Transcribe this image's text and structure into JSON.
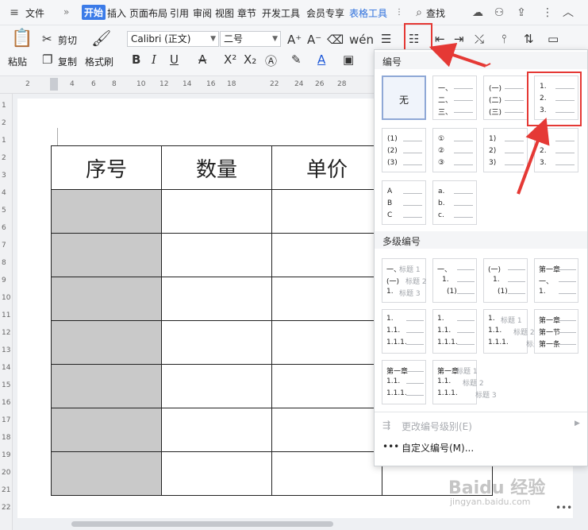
{
  "menubar": {
    "file": "文件",
    "more": "»",
    "tabs": [
      "开始",
      "插入",
      "页面布局",
      "引用",
      "审阅",
      "视图",
      "章节",
      "开发工具",
      "会员专享",
      "表格工具"
    ],
    "search": "查找"
  },
  "ribbon": {
    "paste": "粘贴",
    "cut": "剪切",
    "copy": "复制",
    "format_painter": "格式刷",
    "font_name": "Calibri (正文)",
    "font_size": "二号",
    "bold": "B",
    "italic": "I",
    "underline": "U",
    "strikethrough": "A",
    "superscript": "X²",
    "subscript": "X₂",
    "font_grow": "A⁺",
    "font_shrink": "A⁻"
  },
  "ruler": {
    "h_ticks": [
      "2",
      "2",
      "4",
      "6",
      "8",
      "10",
      "12",
      "14",
      "16",
      "18",
      "22",
      "24",
      "26",
      "28"
    ],
    "v_ticks": [
      "1",
      "2",
      "1",
      "2",
      "3",
      "4",
      "5",
      "6",
      "7",
      "8",
      "9",
      "10",
      "11",
      "12",
      "13",
      "14",
      "15",
      "16",
      "17",
      "18",
      "19",
      "20",
      "21",
      "22"
    ]
  },
  "document": {
    "headers": [
      "序号",
      "数量",
      "单价"
    ],
    "row_count": 7
  },
  "numbering_panel": {
    "section_numbering": "编号",
    "none_label": "无",
    "styles": [
      [
        "一、",
        "二、",
        "三、"
      ],
      [
        "(一)",
        "(二)",
        "(三)"
      ],
      [
        "1.",
        "2.",
        "3."
      ],
      [
        "(1)",
        "(2)",
        "(3)"
      ],
      [
        "①",
        "②",
        "③"
      ],
      [
        "1)",
        "2)",
        "3)"
      ],
      [
        "1.",
        "2.",
        "3."
      ],
      [
        "A",
        "B",
        "C"
      ],
      [
        "a.",
        "b.",
        "c."
      ]
    ],
    "section_multilevel": "多级编号",
    "multilevel": [
      [
        [
          "一、",
          "标题 1"
        ],
        [
          "(一)",
          "标题 2"
        ],
        [
          "1.",
          "标题 3"
        ]
      ],
      [
        [
          "一、",
          ""
        ],
        [
          "1.",
          ""
        ],
        [
          "(1)",
          ""
        ]
      ],
      [
        [
          "(一)",
          ""
        ],
        [
          "1.",
          ""
        ],
        [
          "(1)",
          ""
        ]
      ],
      [
        [
          "第一章",
          ""
        ],
        [
          "一、",
          ""
        ],
        [
          "1.",
          ""
        ]
      ],
      [
        [
          "1.",
          ""
        ],
        [
          "1.1.",
          ""
        ],
        [
          "1.1.1.",
          ""
        ]
      ],
      [
        [
          "1.",
          ""
        ],
        [
          "1.1.",
          ""
        ],
        [
          "1.1.1.",
          ""
        ]
      ],
      [
        [
          "1.",
          "标题 1"
        ],
        [
          "1.1.",
          "标题 2"
        ],
        [
          "1.1.1.",
          "标题 3"
        ]
      ],
      [
        [
          "第一章",
          ""
        ],
        [
          "第一节",
          ""
        ],
        [
          "第一条",
          ""
        ]
      ],
      [
        [
          "第一章",
          ""
        ],
        [
          "1.1.",
          ""
        ],
        [
          "1.1.1.",
          ""
        ]
      ],
      [
        [
          "第一章",
          "标题 1"
        ],
        [
          "1.1.",
          "标题 2"
        ],
        [
          "1.1.1.",
          "标题 3"
        ]
      ]
    ],
    "change_level": "更改编号级别(E)",
    "custom": "自定义编号(M)..."
  },
  "watermark": "Baidu 经验",
  "watermark_url": "jingyan.baidu.com",
  "colors": {
    "accent": "#3b7be8",
    "annotation": "#e53935",
    "table_fill": "#c9c9c9"
  }
}
